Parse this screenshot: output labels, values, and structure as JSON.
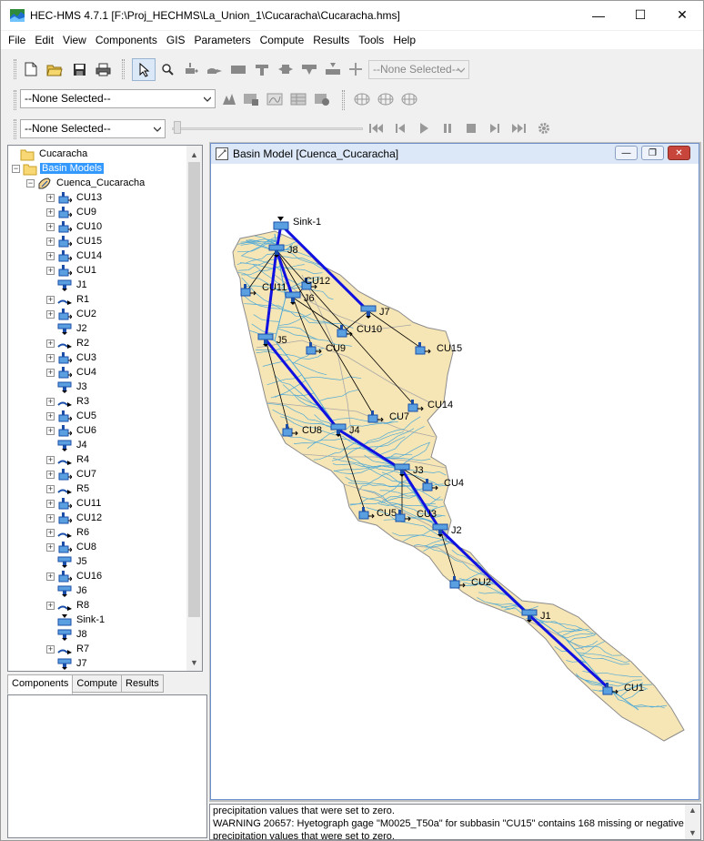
{
  "app": {
    "title": "HEC-HMS 4.7.1 [F:\\Proj_HECHMS\\La_Union_1\\Cucaracha\\Cucaracha.hms]",
    "window_controls": {
      "minimize": "—",
      "maximize": "☐",
      "close": "✕"
    }
  },
  "menu": [
    "File",
    "Edit",
    "View",
    "Components",
    "GIS",
    "Parameters",
    "Compute",
    "Results",
    "Tools",
    "Help"
  ],
  "toolbar": {
    "element_select": "--None Selected--",
    "run_select": "--None Selected--",
    "animation_select": "--None Selected--"
  },
  "tree": {
    "root": "Cucaracha",
    "basin_models": "Basin Models",
    "basin": "Cuenca_Cucaracha",
    "items": [
      {
        "label": "CU13",
        "type": "subbasin",
        "exp": true
      },
      {
        "label": "CU9",
        "type": "subbasin",
        "exp": true
      },
      {
        "label": "CU10",
        "type": "subbasin",
        "exp": true
      },
      {
        "label": "CU15",
        "type": "subbasin",
        "exp": true
      },
      {
        "label": "CU14",
        "type": "subbasin",
        "exp": true
      },
      {
        "label": "CU1",
        "type": "subbasin",
        "exp": true
      },
      {
        "label": "J1",
        "type": "junction",
        "exp": false
      },
      {
        "label": "R1",
        "type": "reach",
        "exp": true
      },
      {
        "label": "CU2",
        "type": "subbasin",
        "exp": true
      },
      {
        "label": "J2",
        "type": "junction",
        "exp": false
      },
      {
        "label": "R2",
        "type": "reach",
        "exp": true
      },
      {
        "label": "CU3",
        "type": "subbasin",
        "exp": true
      },
      {
        "label": "CU4",
        "type": "subbasin",
        "exp": true
      },
      {
        "label": "J3",
        "type": "junction",
        "exp": false
      },
      {
        "label": "R3",
        "type": "reach",
        "exp": true
      },
      {
        "label": "CU5",
        "type": "subbasin",
        "exp": true
      },
      {
        "label": "CU6",
        "type": "subbasin",
        "exp": true
      },
      {
        "label": "J4",
        "type": "junction",
        "exp": false
      },
      {
        "label": "R4",
        "type": "reach",
        "exp": true
      },
      {
        "label": "CU7",
        "type": "subbasin",
        "exp": true
      },
      {
        "label": "R5",
        "type": "reach",
        "exp": true
      },
      {
        "label": "CU11",
        "type": "subbasin",
        "exp": true
      },
      {
        "label": "CU12",
        "type": "subbasin",
        "exp": true
      },
      {
        "label": "R6",
        "type": "reach",
        "exp": true
      },
      {
        "label": "CU8",
        "type": "subbasin",
        "exp": true
      },
      {
        "label": "J5",
        "type": "junction",
        "exp": false
      },
      {
        "label": "CU16",
        "type": "subbasin",
        "exp": true
      },
      {
        "label": "J6",
        "type": "junction",
        "exp": false
      },
      {
        "label": "R8",
        "type": "reach",
        "exp": true
      },
      {
        "label": "Sink-1",
        "type": "sink",
        "exp": false
      },
      {
        "label": "J8",
        "type": "junction",
        "exp": false
      },
      {
        "label": "R7",
        "type": "reach",
        "exp": true
      },
      {
        "label": "J7",
        "type": "junction",
        "exp": false
      }
    ]
  },
  "tabs": [
    "Components",
    "Compute",
    "Results"
  ],
  "basin_window": {
    "title": "Basin Model [Cuenca_Cucaracha]"
  },
  "map": {
    "basin_fill": "#f7e6b5",
    "stream_color": "#4fa9d6",
    "reach_color": "#1010e0",
    "connector_color": "#000000",
    "nodes": [
      {
        "label": "Sink-1",
        "type": "sink"
      },
      {
        "label": "J8",
        "type": "junction"
      },
      {
        "label": "CU12",
        "type": "subbasin"
      },
      {
        "label": "CU11",
        "type": "subbasin"
      },
      {
        "label": "J6",
        "type": "junction"
      },
      {
        "label": "J7",
        "type": "junction"
      },
      {
        "label": "CU10",
        "type": "subbasin"
      },
      {
        "label": "J5",
        "type": "junction"
      },
      {
        "label": "CU9",
        "type": "subbasin"
      },
      {
        "label": "CU15",
        "type": "subbasin"
      },
      {
        "label": "CU14",
        "type": "subbasin"
      },
      {
        "label": "CU7",
        "type": "subbasin"
      },
      {
        "label": "CU8",
        "type": "subbasin"
      },
      {
        "label": "J4",
        "type": "junction"
      },
      {
        "label": "J3",
        "type": "junction"
      },
      {
        "label": "CU4",
        "type": "subbasin"
      },
      {
        "label": "CU5",
        "type": "subbasin"
      },
      {
        "label": "CU3",
        "type": "subbasin"
      },
      {
        "label": "J2",
        "type": "junction"
      },
      {
        "label": "CU2",
        "type": "subbasin"
      },
      {
        "label": "J1",
        "type": "junction"
      },
      {
        "label": "CU1",
        "type": "subbasin"
      }
    ]
  },
  "messages": [
    "precipitation values that were set to zero.",
    "WARNING 20657:  Hyetograph gage \"M0025_T50a\" for subbasin \"CU15\" contains 168 missing or negative",
    "precipitation values that were set to zero."
  ]
}
